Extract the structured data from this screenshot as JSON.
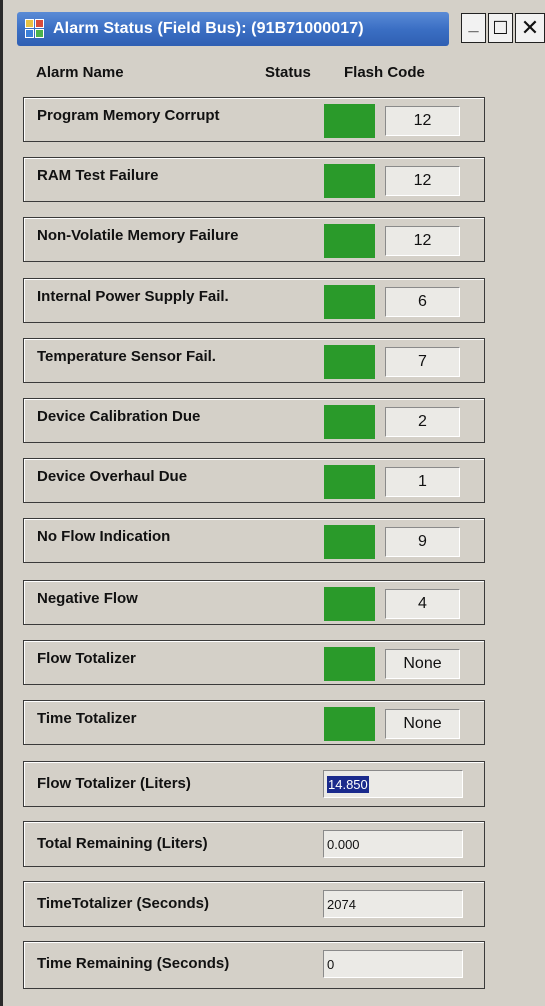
{
  "window": {
    "title": "Alarm Status (Field Bus): (91B71000017)",
    "controls": {
      "minimize": "_",
      "maximize": "☐",
      "close": "✕"
    }
  },
  "headers": {
    "alarm_name": "Alarm Name",
    "status": "Status",
    "flash_code": "Flash Code"
  },
  "alarms": [
    {
      "name": "Program Memory Corrupt",
      "status_color": "#2a9a2a",
      "flash_code": "12"
    },
    {
      "name": "RAM Test Failure",
      "status_color": "#2a9a2a",
      "flash_code": "12"
    },
    {
      "name": "Non-Volatile Memory Failure",
      "status_color": "#2a9a2a",
      "flash_code": "12"
    },
    {
      "name": "Internal Power Supply Fail.",
      "status_color": "#2a9a2a",
      "flash_code": "6"
    },
    {
      "name": "Temperature Sensor Fail.",
      "status_color": "#2a9a2a",
      "flash_code": "7"
    },
    {
      "name": "Device Calibration Due",
      "status_color": "#2a9a2a",
      "flash_code": "2"
    },
    {
      "name": "Device Overhaul Due",
      "status_color": "#2a9a2a",
      "flash_code": "1"
    },
    {
      "name": "No Flow Indication",
      "status_color": "#2a9a2a",
      "flash_code": "9"
    },
    {
      "name": "Negative Flow",
      "status_color": "#2a9a2a",
      "flash_code": "4"
    },
    {
      "name": "Flow Totalizer",
      "status_color": "#2a9a2a",
      "flash_code": "None"
    },
    {
      "name": "Time Totalizer",
      "status_color": "#2a9a2a",
      "flash_code": "None"
    }
  ],
  "values": [
    {
      "name": "Flow Totalizer (Liters)",
      "value": "14.850",
      "selected": true
    },
    {
      "name": "Total Remaining (Liters)",
      "value": "0.000",
      "selected": false
    },
    {
      "name": "TimeTotalizer (Seconds)",
      "value": "2074",
      "selected": false
    },
    {
      "name": "Time Remaining (Seconds)",
      "value": "0",
      "selected": false
    }
  ]
}
